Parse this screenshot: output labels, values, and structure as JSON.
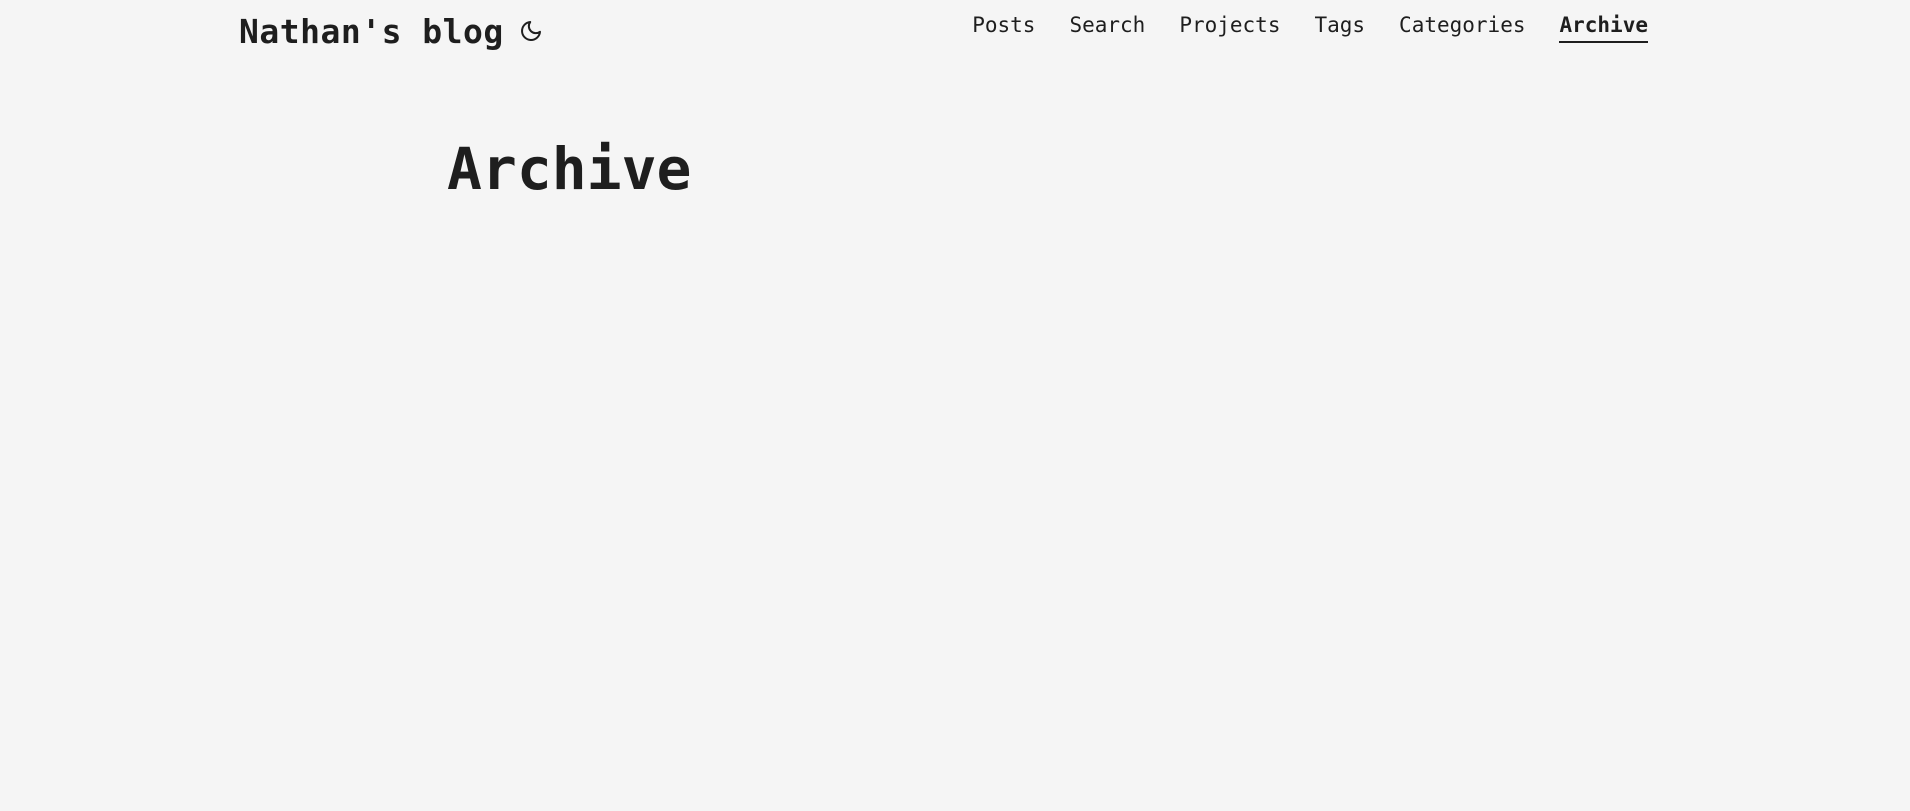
{
  "header": {
    "logo_text": "Nathan's blog",
    "theme_toggle_icon": "moon-icon",
    "nav": [
      {
        "label": "Posts",
        "active": false
      },
      {
        "label": "Search",
        "active": false
      },
      {
        "label": "Projects",
        "active": false
      },
      {
        "label": "Tags",
        "active": false
      },
      {
        "label": "Categories",
        "active": false
      },
      {
        "label": "Archive",
        "active": true
      }
    ]
  },
  "main": {
    "title": "Archive"
  },
  "colors": {
    "background": "#f5f5f5",
    "text": "#1e1e1e"
  }
}
